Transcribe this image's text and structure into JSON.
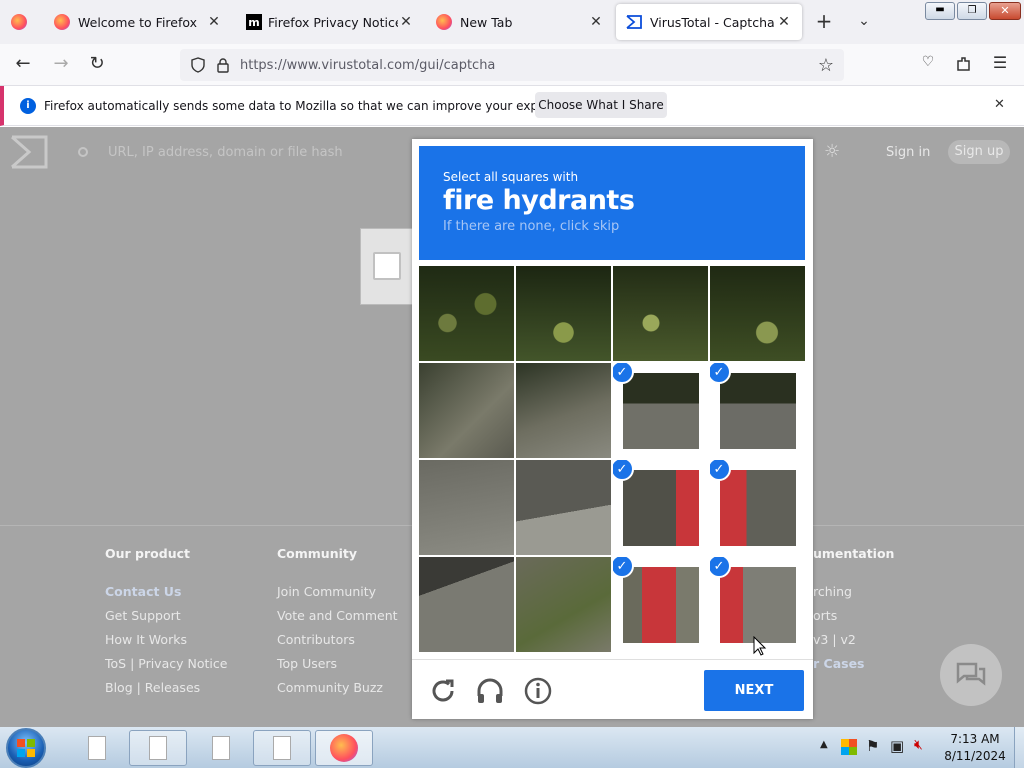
{
  "browser": {
    "tabs": [
      {
        "label": "Welcome to Firefox"
      },
      {
        "label": "Firefox Privacy Notice —"
      },
      {
        "label": "New Tab"
      },
      {
        "label": "VirusTotal - Captcha"
      }
    ],
    "url": "https://www.virustotal.com/gui/captcha",
    "notification": {
      "text": "Firefox automatically sends some data to Mozilla so that we can improve your experience.",
      "button": "Choose What I Share"
    }
  },
  "vt": {
    "search_placeholder": "URL, IP address, domain or file hash",
    "sign_in": "Sign in",
    "sign_up": "Sign up",
    "footer": [
      {
        "heading": "Our product",
        "links": [
          "Contact Us",
          "Get Support",
          "How It Works",
          "ToS | Privacy Notice",
          "Blog | Releases"
        ]
      },
      {
        "heading": "Community",
        "links": [
          "Join Community",
          "Vote and Comment",
          "Contributors",
          "Top Users",
          "Community Buzz"
        ]
      },
      {
        "heading": "umentation",
        "links": [
          "rching",
          "orts",
          "v3 | v2",
          "r Cases"
        ]
      }
    ]
  },
  "captcha": {
    "instruction": "Select all squares with",
    "target": "fire hydrants",
    "hint": "If there are none, click skip",
    "next": "NEXT",
    "selected": [
      6,
      7,
      10,
      11,
      14,
      15
    ]
  },
  "taskbar": {
    "time": "7:13 AM",
    "date": "8/11/2024"
  }
}
